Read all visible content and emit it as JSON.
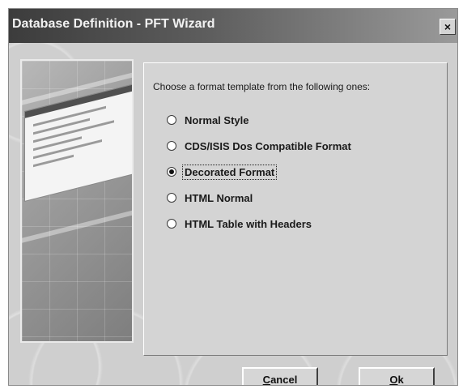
{
  "window": {
    "title": "Database Definition - PFT Wizard",
    "close_glyph": "×"
  },
  "panel": {
    "prompt": "Choose a format template from the following ones:",
    "options": [
      {
        "label": "Normal Style",
        "selected": false
      },
      {
        "label": "CDS/ISIS Dos Compatible Format",
        "selected": false
      },
      {
        "label": "Decorated Format",
        "selected": true
      },
      {
        "label": "HTML Normal",
        "selected": false
      },
      {
        "label": "HTML Table with Headers",
        "selected": false
      }
    ]
  },
  "buttons": {
    "cancel": {
      "mnemonic": "C",
      "rest": "ancel"
    },
    "ok": {
      "mnemonic": "O",
      "rest": "k"
    }
  },
  "colors": {
    "title_bar_start": "#3c3c3c",
    "title_bar_end": "#9a9a9a",
    "window_face": "#d4d4d4"
  }
}
